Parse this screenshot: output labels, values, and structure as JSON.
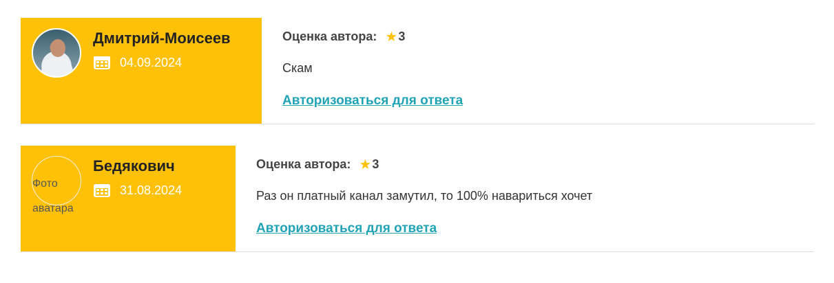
{
  "reviews": [
    {
      "author": "Дмитрий-Моисеев",
      "date": "04.09.2024",
      "avatar_alt": "",
      "rating_label": "Оценка автора:",
      "rating_value": "3",
      "text": "Скам",
      "reply_link": "Авторизоваться для ответа"
    },
    {
      "author": "Бедякович",
      "date": "31.08.2024",
      "avatar_alt": "Фото аватара",
      "rating_label": "Оценка автора:",
      "rating_value": "3",
      "text": "Раз он платный канал замутил, то 100% навариться хочет",
      "reply_link": "Авторизоваться для ответа"
    }
  ],
  "icons": {
    "calendar": "calendar-icon",
    "star": "star-icon"
  },
  "colors": {
    "panel": "#ffc107",
    "link": "#1fa3b5",
    "star": "#ffc107"
  }
}
